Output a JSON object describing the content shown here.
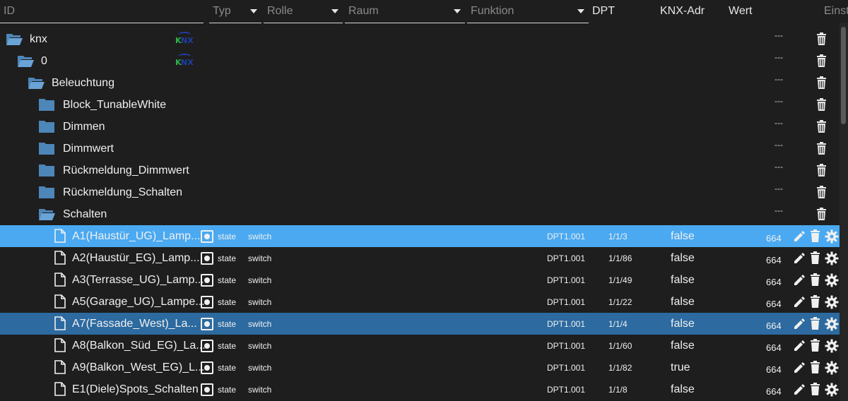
{
  "header": {
    "id_placeholder": "ID",
    "typ_placeholder": "Typ",
    "rolle_placeholder": "Rolle",
    "raum_placeholder": "Raum",
    "funktion_placeholder": "Funktion",
    "dpt_label": "DPT",
    "knx_label": "KNX-Adr",
    "wert_label": "Wert",
    "einst_label": "Einst"
  },
  "tree": [
    {
      "name": "knx",
      "dash": "---"
    },
    {
      "name": "0",
      "dash": "---"
    },
    {
      "name": "Beleuchtung",
      "dash": "---"
    },
    {
      "name": "Block_TunableWhite",
      "dash": "---"
    },
    {
      "name": "Dimmen",
      "dash": "---"
    },
    {
      "name": "Dimmwert",
      "dash": "---"
    },
    {
      "name": "Rückmeldung_Dimmwert",
      "dash": "---"
    },
    {
      "name": "Rückmeldung_Schalten",
      "dash": "---"
    },
    {
      "name": "Schalten",
      "dash": "---"
    }
  ],
  "logo_text": {
    "k": "K",
    "nx": "NX"
  },
  "states": [
    {
      "name": "A1(Haustür_UG)_Lamp...",
      "role": "state",
      "function": "switch",
      "dpt": "DPT1.001",
      "address": "1/1/3",
      "value": "false",
      "number": "664"
    },
    {
      "name": "A2(Haustür_EG)_Lamp...",
      "role": "state",
      "function": "switch",
      "dpt": "DPT1.001",
      "address": "1/1/86",
      "value": "false",
      "number": "664"
    },
    {
      "name": "A3(Terrasse_UG)_Lamp...",
      "role": "state",
      "function": "switch",
      "dpt": "DPT1.001",
      "address": "1/1/49",
      "value": "false",
      "number": "664"
    },
    {
      "name": "A5(Garage_UG)_Lampe...",
      "role": "state",
      "function": "switch",
      "dpt": "DPT1.001",
      "address": "1/1/22",
      "value": "false",
      "number": "664"
    },
    {
      "name": "A7(Fassade_West)_La...",
      "role": "state",
      "function": "switch",
      "dpt": "DPT1.001",
      "address": "1/1/4",
      "value": "false",
      "number": "664"
    },
    {
      "name": "A8(Balkon_Süd_EG)_La...",
      "role": "state",
      "function": "switch",
      "dpt": "DPT1.001",
      "address": "1/1/60",
      "value": "false",
      "number": "664"
    },
    {
      "name": "A9(Balkon_West_EG)_L...",
      "role": "state",
      "function": "switch",
      "dpt": "DPT1.001",
      "address": "1/1/82",
      "value": "true",
      "number": "664"
    },
    {
      "name": "E1(Diele)Spots_Schalten",
      "role": "state",
      "function": "switch",
      "dpt": "DPT1.001",
      "address": "1/1/8",
      "value": "false",
      "number": "664"
    }
  ],
  "colors": {
    "background": "#1e1e1e",
    "selected_primary": "#4aa9f1",
    "selected_secondary": "#2c6aa0",
    "folder": "#4d86b8"
  }
}
